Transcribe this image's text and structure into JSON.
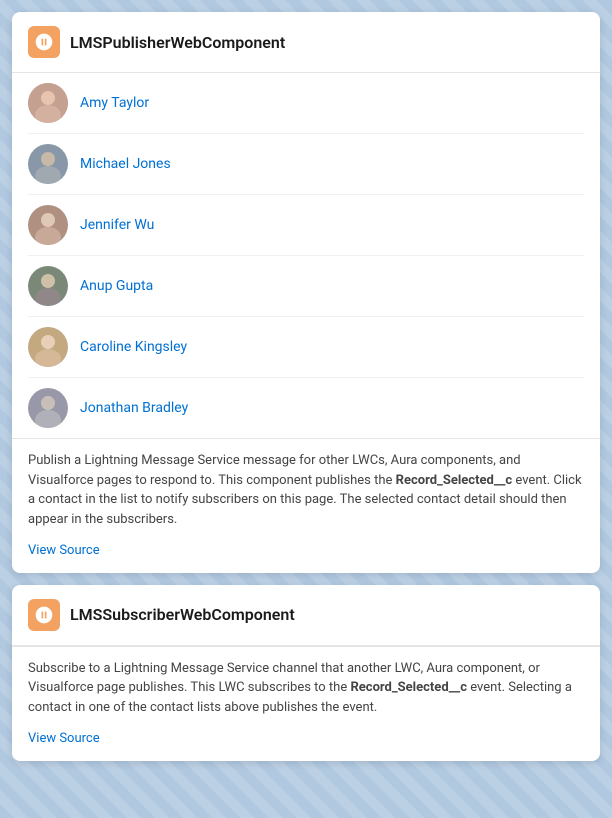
{
  "publisher_card": {
    "title": "LMSPublisherWebComponent",
    "icon_label": "publisher-icon",
    "contacts": [
      {
        "name": "Amy Taylor",
        "id": "amy-taylor",
        "avatar_color": "#c4857a"
      },
      {
        "name": "Michael Jones",
        "id": "michael-jones",
        "avatar_color": "#8a9bb0"
      },
      {
        "name": "Jennifer Wu",
        "id": "jennifer-wu",
        "avatar_color": "#b09080"
      },
      {
        "name": "Anup Gupta",
        "id": "anup-gupta",
        "avatar_color": "#7a8a7a"
      },
      {
        "name": "Caroline Kingsley",
        "id": "caroline-kingsley",
        "avatar_color": "#c4a080"
      },
      {
        "name": "Jonathan Bradley",
        "id": "jonathan-bradley",
        "avatar_color": "#9090a0"
      }
    ],
    "description_parts": [
      "Publish a Lightning Message Service message for other LWCs, Aura components, and Visualforce pages to respond to. This component publishes the ",
      "Record_Selected__c",
      " event. Click a contact in the list to notify subscribers on this page. The selected contact detail should then appear in the subscribers."
    ],
    "view_source_label": "View Source"
  },
  "subscriber_card": {
    "title": "LMSSubscriberWebComponent",
    "icon_label": "subscriber-icon",
    "description_parts": [
      "Subscribe to a Lightning Message Service channel that another LWC, Aura component, or Visualforce page publishes. This LWC subscribes to the ",
      "Record_Selected__c",
      " event. Selecting a contact in one of the contact lists above publishes the event."
    ],
    "view_source_label": "View Source"
  }
}
